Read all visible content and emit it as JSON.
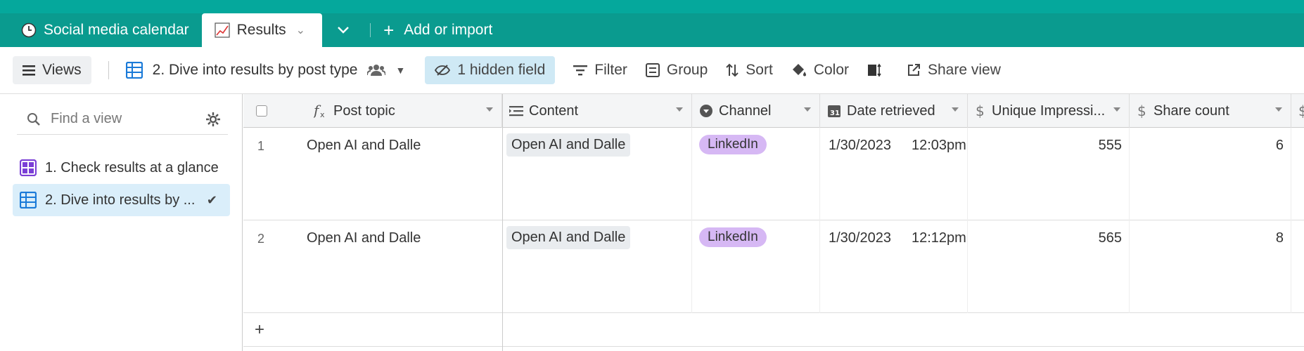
{
  "tabs": [
    {
      "label": "Social media calendar",
      "icon": "clock-icon"
    },
    {
      "label": "Results",
      "icon": "chart-icon",
      "active": true
    }
  ],
  "add_import": "Add or import",
  "toolbar": {
    "views": "Views",
    "view_name": "2. Dive into results by post type",
    "hidden_fields": "1 hidden field",
    "filter": "Filter",
    "group": "Group",
    "sort": "Sort",
    "color": "Color",
    "share_view": "Share view"
  },
  "sidebar": {
    "search_placeholder": "Find a view",
    "items": [
      {
        "label": "1. Check results at a glance",
        "icon": "gallery-icon"
      },
      {
        "label": "2. Dive into results by ...",
        "icon": "grid-icon",
        "active": true
      }
    ]
  },
  "columns": [
    "Post topic",
    "Content",
    "Channel",
    "Date retrieved",
    "Unique Impressi...",
    "Share count"
  ],
  "rows": [
    {
      "n": "1",
      "topic": "Open AI and Dalle",
      "content": "Open AI and Dalle",
      "channel": "LinkedIn",
      "date": "1/30/2023",
      "time": "12:03pm",
      "impressions": "555",
      "shares": "6"
    },
    {
      "n": "2",
      "topic": "Open AI and Dalle",
      "content": "Open AI and Dalle",
      "channel": "LinkedIn",
      "date": "1/30/2023",
      "time": "12:12pm",
      "impressions": "565",
      "shares": "8"
    }
  ],
  "colors": {
    "teal": "#0a9b8f",
    "channel_pill": "#d6b8f4",
    "hidden_field_bg": "#cfe9f5",
    "active_view_bg": "#daeefa"
  }
}
